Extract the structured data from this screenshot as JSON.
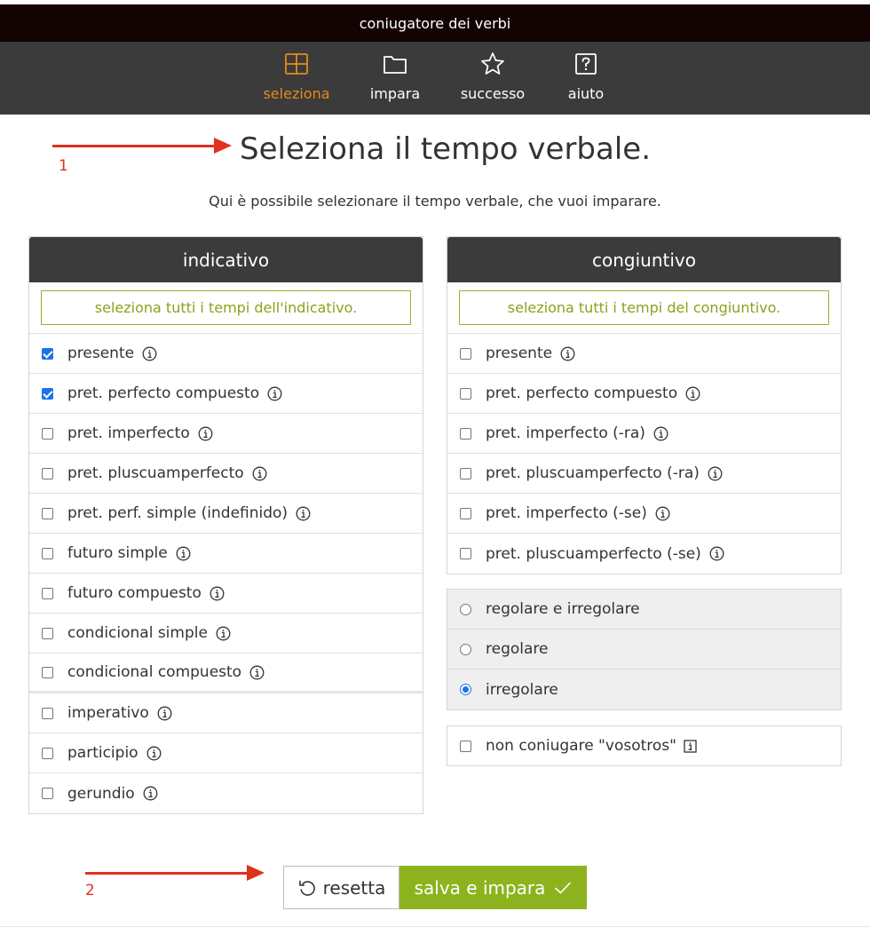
{
  "app": {
    "title": "coniugatore dei verbi"
  },
  "nav": [
    {
      "label": "seleziona",
      "icon": "grid-icon",
      "active": true
    },
    {
      "label": "impara",
      "icon": "folder-icon",
      "active": false
    },
    {
      "label": "successo",
      "icon": "star-icon",
      "active": false
    },
    {
      "label": "aiuto",
      "icon": "question-icon",
      "active": false
    }
  ],
  "annotations": {
    "first": "1",
    "second": "2"
  },
  "page": {
    "title": "Seleziona il tempo verbale.",
    "subtitle": "Qui è possibile selezionare il tempo verbale, che vuoi imparare."
  },
  "indicativo": {
    "heading": "indicativo",
    "select_all": "seleziona tutti i tempi dell'indicativo.",
    "items": [
      {
        "label": "presente",
        "checked": true
      },
      {
        "label": "pret. perfecto compuesto",
        "checked": true
      },
      {
        "label": "pret. imperfecto",
        "checked": false
      },
      {
        "label": "pret. pluscuamperfecto",
        "checked": false
      },
      {
        "label": "pret. perf. simple (indefinido)",
        "checked": false
      },
      {
        "label": "futuro simple",
        "checked": false
      },
      {
        "label": "futuro compuesto",
        "checked": false
      },
      {
        "label": "condicional simple",
        "checked": false
      },
      {
        "label": "condicional compuesto",
        "checked": false
      },
      {
        "label": "imperativo",
        "checked": false
      },
      {
        "label": "participio",
        "checked": false
      },
      {
        "label": "gerundio",
        "checked": false
      }
    ]
  },
  "congiuntivo": {
    "heading": "congiuntivo",
    "select_all": "seleziona tutti i tempi del congiuntivo.",
    "items": [
      {
        "label": "presente",
        "checked": false
      },
      {
        "label": "pret. perfecto compuesto",
        "checked": false
      },
      {
        "label": "pret. imperfecto (-ra)",
        "checked": false
      },
      {
        "label": "pret. pluscuamperfecto (-ra)",
        "checked": false
      },
      {
        "label": "pret. imperfecto (-se)",
        "checked": false
      },
      {
        "label": "pret. pluscuamperfecto (-se)",
        "checked": false
      }
    ]
  },
  "verb_type": {
    "options": [
      {
        "label": "regolare e irregolare",
        "selected": false
      },
      {
        "label": "regolare",
        "selected": false
      },
      {
        "label": "irregolare",
        "selected": true
      }
    ]
  },
  "vosotros": {
    "label": "non coniugare \"vosotros\"",
    "checked": false
  },
  "buttons": {
    "reset": "resetta",
    "save": "salva e impara"
  },
  "colors": {
    "accent_orange": "#e88a1a",
    "accent_green": "#8cb31d",
    "annotation_red": "#e0301e",
    "nav_bg": "#3b3b3b"
  }
}
